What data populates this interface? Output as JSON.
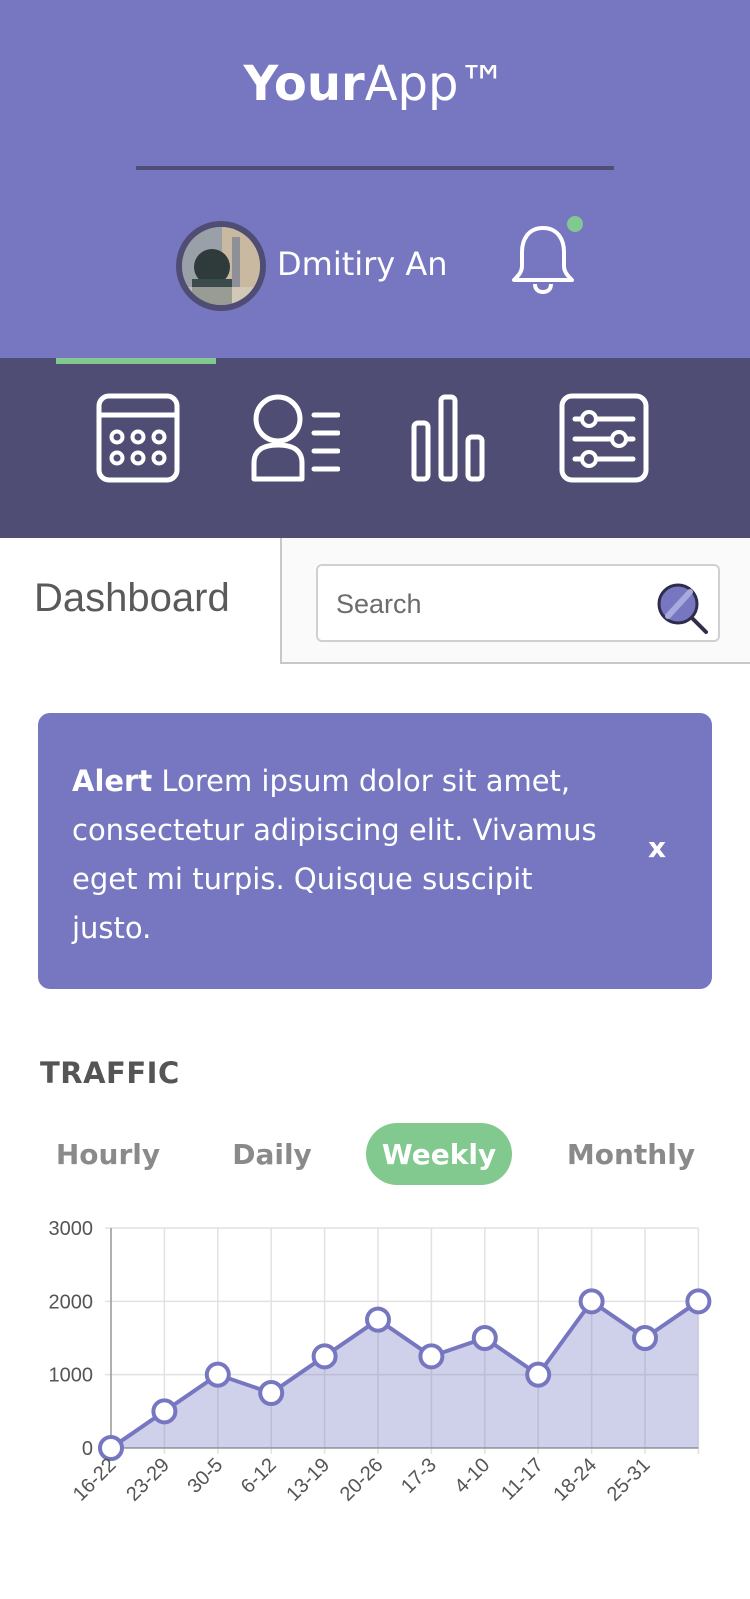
{
  "app": {
    "title_bold": "Your",
    "title_light": "App™"
  },
  "user": {
    "name": "Dmitiry An"
  },
  "nav": {
    "items": [
      {
        "icon": "calendar-icon"
      },
      {
        "icon": "members-icon"
      },
      {
        "icon": "bar-chart-icon"
      },
      {
        "icon": "settings-sliders-icon"
      }
    ]
  },
  "page": {
    "title": "Dashboard"
  },
  "search": {
    "placeholder": "Search"
  },
  "alert": {
    "label": "Alert",
    "message": " Lorem ipsum dolor sit amet, consectetur adipiscing elit. Vivamus eget mi turpis. Quisque suscipit justo.",
    "close": "x"
  },
  "traffic": {
    "title": "TRAFFIC",
    "tabs": [
      "Hourly",
      "Daily",
      "Weekly",
      "Monthly"
    ],
    "active_tab": "Weekly"
  },
  "colors": {
    "primary": "#7677c0",
    "dark": "#4f4d74",
    "accent": "#81c98f"
  },
  "chart_data": {
    "type": "area",
    "categories": [
      "16-22",
      "23-29",
      "30-5",
      "6-12",
      "13-19",
      "20-26",
      "17-3",
      "4-10",
      "11-17",
      "18-24",
      "25-31",
      ""
    ],
    "values": [
      0,
      500,
      1000,
      750,
      1250,
      1750,
      1250,
      1500,
      1000,
      2000,
      1500,
      2000
    ],
    "ylim": [
      0,
      3000
    ],
    "yticks": [
      0,
      1000,
      2000,
      3000
    ],
    "grid": true,
    "xlabel": "",
    "ylabel": "",
    "title": ""
  }
}
